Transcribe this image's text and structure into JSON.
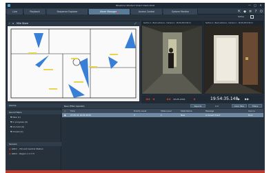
{
  "window": {
    "title": "Milestone XProtect Smart Client 2016",
    "controls": [
      "—",
      "□",
      "✕"
    ]
  },
  "tabs": [
    {
      "label": "Live",
      "active": false
    },
    {
      "label": "Playback",
      "active": false
    },
    {
      "label": "Sequence Explorer",
      "active": false
    },
    {
      "label": "Alarm Manager",
      "active": true,
      "alert": true
    },
    {
      "label": "Access Control",
      "active": false
    },
    {
      "label": "System Monitor",
      "active": false
    }
  ],
  "toolbar_icons": [
    "pin-icon",
    "bell-icon",
    "gear-icon",
    "help-icon",
    "power-icon"
  ],
  "setup": {
    "label": "Setup"
  },
  "map": {
    "title": "Mile Store"
  },
  "cameras": [
    {
      "header": "Section A - Back entrance - Camera 2 - 18-05-2016 09:11"
    },
    {
      "header": "Section A - Back entrance - Camera 1 - 18-05-2016 09:11"
    }
  ],
  "playback": {
    "date": "18-05-2016",
    "time": "19:54:35.148",
    "accent": "#c23a2a"
  },
  "alarms_panel": {
    "title": "Alarms",
    "quick_filters_title": "Quick Filters",
    "filters": [
      "New (1)",
      "In progress (0)",
      "On hold (0)",
      "Closed (2)"
    ],
    "servers_title": "Servers",
    "servers": [
      "GRCC - HQ and Central Station",
      "GRCC - Region 1    2   3   5"
    ]
  },
  "alarm_list": {
    "filter_label": "New (Filter Applied)",
    "reports_button": "Reports",
    "pager": "1-1",
    "clear_filter_button": "Clear filter",
    "filters_button": "Filters",
    "columns": [
      "Time",
      "Priority Level",
      "State Level",
      "State Name",
      "Message",
      "Source"
    ],
    "rows": [
      {
        "time": "07:05:41 18-05-2016",
        "priority": "2",
        "state_level": "1",
        "state_name": "New",
        "message": "Licensed Event",
        "source": "Door"
      }
    ]
  }
}
